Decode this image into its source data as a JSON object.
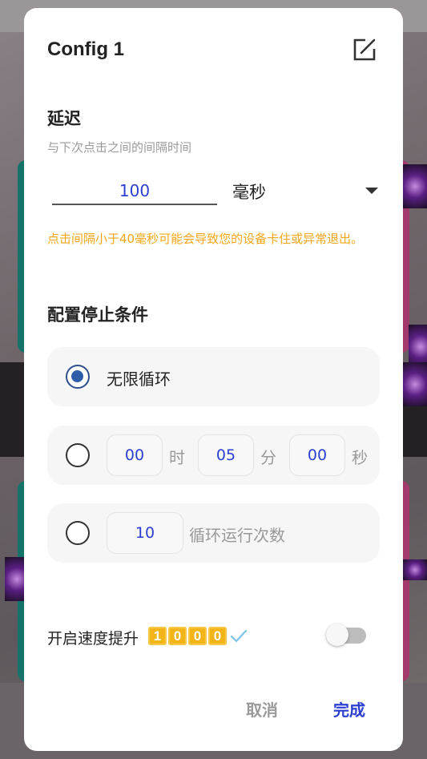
{
  "dialog": {
    "title": "Config 1"
  },
  "delay": {
    "title": "延迟",
    "subtitle": "与下次点击之间的间隔时间",
    "value": "100",
    "unit": "毫秒",
    "warning": "点击间隔小于40毫秒可能会导致您的设备卡住或异常退出。"
  },
  "stop_conditions": {
    "title": "配置停止条件",
    "infinite_label": "无限循环",
    "timer": {
      "hours": "00",
      "hours_unit": "时",
      "minutes": "05",
      "minutes_unit": "分",
      "seconds": "00",
      "seconds_unit": "秒"
    },
    "loop": {
      "count": "10",
      "label": "循环运行次数"
    },
    "selected": "infinite"
  },
  "speed_boost": {
    "label": "开启速度提升",
    "badge_digits": [
      "1",
      "0",
      "0",
      "0"
    ],
    "enabled": false
  },
  "actions": {
    "cancel": "取消",
    "done": "完成"
  },
  "colors": {
    "accent": "#2b3fd0",
    "warning": "#f2a71b",
    "radio_selected": "#2f5ea8",
    "badge": "#f2b416"
  },
  "icons": {
    "edit": "edit-icon",
    "dropdown": "dropdown-arrow-icon",
    "check": "check-icon"
  }
}
